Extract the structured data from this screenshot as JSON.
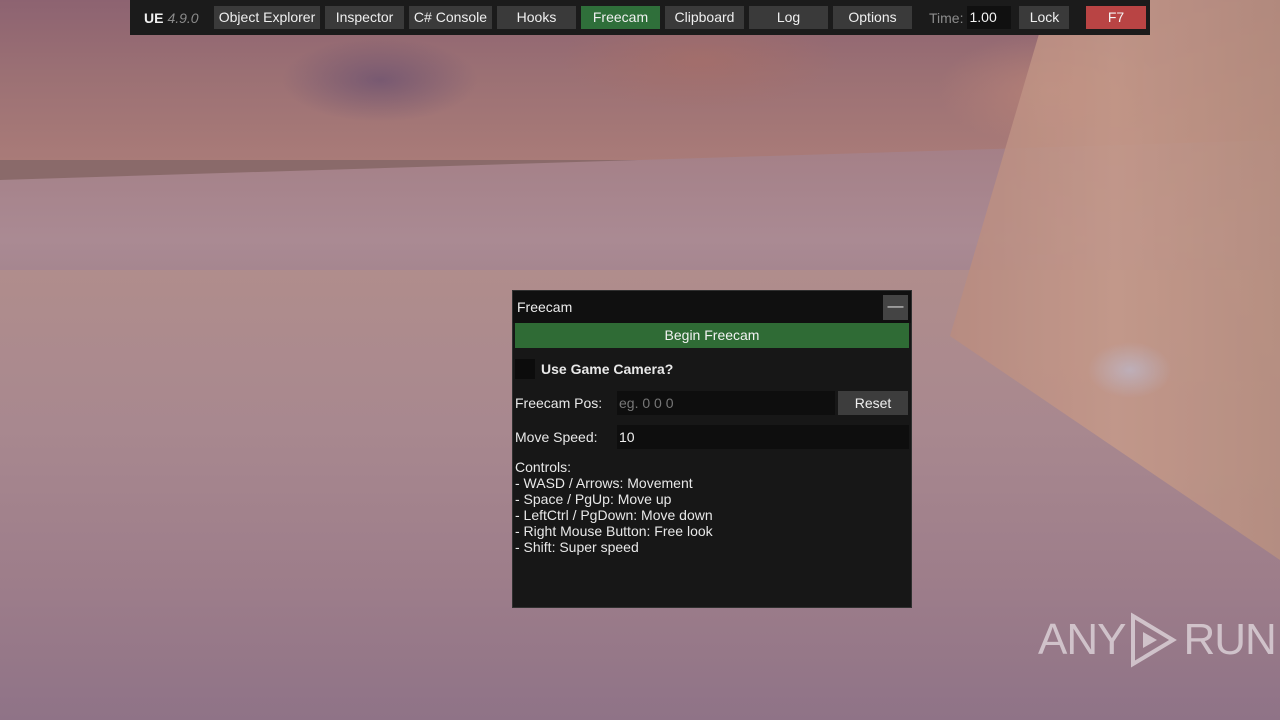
{
  "toolbar": {
    "brand": "UE",
    "version": "4.9.0",
    "buttons": [
      {
        "label": "Object Explorer"
      },
      {
        "label": "Inspector"
      },
      {
        "label": "C# Console"
      },
      {
        "label": "Hooks"
      },
      {
        "label": "Freecam"
      },
      {
        "label": "Clipboard"
      },
      {
        "label": "Log"
      },
      {
        "label": "Options"
      }
    ],
    "time_label": "Time:",
    "time_value": "1.00",
    "lock_label": "Lock",
    "toggle_key_label": "F7",
    "active_tab": "Freecam"
  },
  "freecam": {
    "title": "Freecam",
    "minimize_label": "—",
    "begin_label": "Begin Freecam",
    "use_game_camera_label": "Use Game Camera?",
    "use_game_camera_checked": false,
    "pos_label": "Freecam Pos:",
    "pos_placeholder": "eg. 0 0 0",
    "pos_value": "",
    "reset_label": "Reset",
    "speed_label": "Move Speed:",
    "speed_value": "10",
    "controls_title": "Controls:",
    "controls": [
      "- WASD / Arrows: Movement",
      "- Space / PgUp: Move up",
      "- LeftCtrl / PgDown: Move down",
      "- Right Mouse Button: Free look",
      "- Shift: Super speed"
    ]
  },
  "watermark": {
    "left": "ANY",
    "right": "RUN"
  },
  "colors": {
    "active_button": "#2f6f3a",
    "toggle_key": "#b94444",
    "begin_button": "#2f6b35"
  }
}
